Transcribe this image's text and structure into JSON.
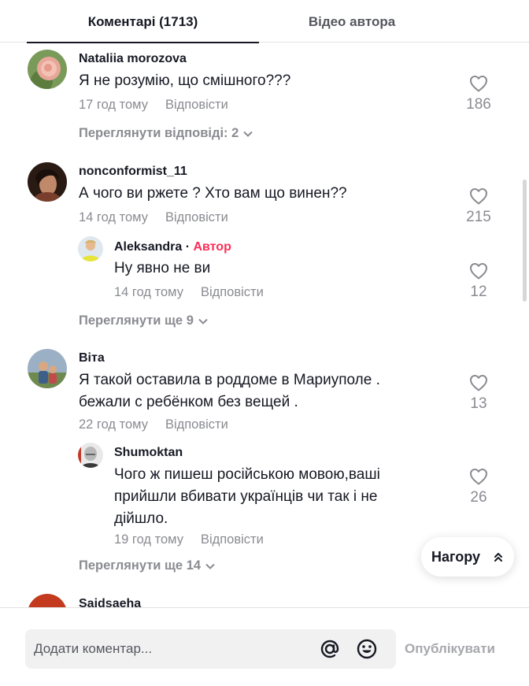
{
  "tabs": {
    "comments": "Коментарі (1713)",
    "author_videos": "Відео автора"
  },
  "comments": [
    {
      "username": "Nataliia morozova",
      "text": "Я не розумію, що смішного???",
      "time": "17 год тому",
      "reply": "Відповісти",
      "likes": "186",
      "view_more": "Переглянути відповіді: 2"
    },
    {
      "username": "nonconformist_11",
      "text": "А чого ви ржете ? Хто вам що винен??",
      "time": "14 год тому",
      "reply": "Відповісти",
      "likes": "215",
      "view_more": "Переглянути ще 9",
      "replies": [
        {
          "username": "Aleksandra",
          "author_badge": "Автор",
          "text": "Ну явно не ви",
          "time": "14 год тому",
          "reply": "Відповісти",
          "likes": "12"
        }
      ]
    },
    {
      "username": "Віта",
      "text": "Я такой оставила в роддоме в Мариуполе . бежали с ребёнком без вещей .",
      "time": "22 год тому",
      "reply": "Відповісти",
      "likes": "13",
      "view_more": "Переглянути ще 14",
      "replies": [
        {
          "username": "Shumoktan",
          "text": "Чого ж пишеш російською мовою,ваші прийшли вбивати українців чи так і не дійшло.",
          "time": "19 год тому",
          "reply": "Відповісти",
          "likes": "26"
        }
      ]
    },
    {
      "username": "Saidsaeha"
    }
  ],
  "back_to_top": "Нагору",
  "composer": {
    "placeholder": "Додати коментар...",
    "publish": "Опублікувати"
  },
  "colors": {
    "text": "#161823",
    "muted": "#8a8b91",
    "author_badge": "#fe2c55",
    "input_bg": "#f1f1f2",
    "publish_disabled": "#a7a8ac"
  }
}
